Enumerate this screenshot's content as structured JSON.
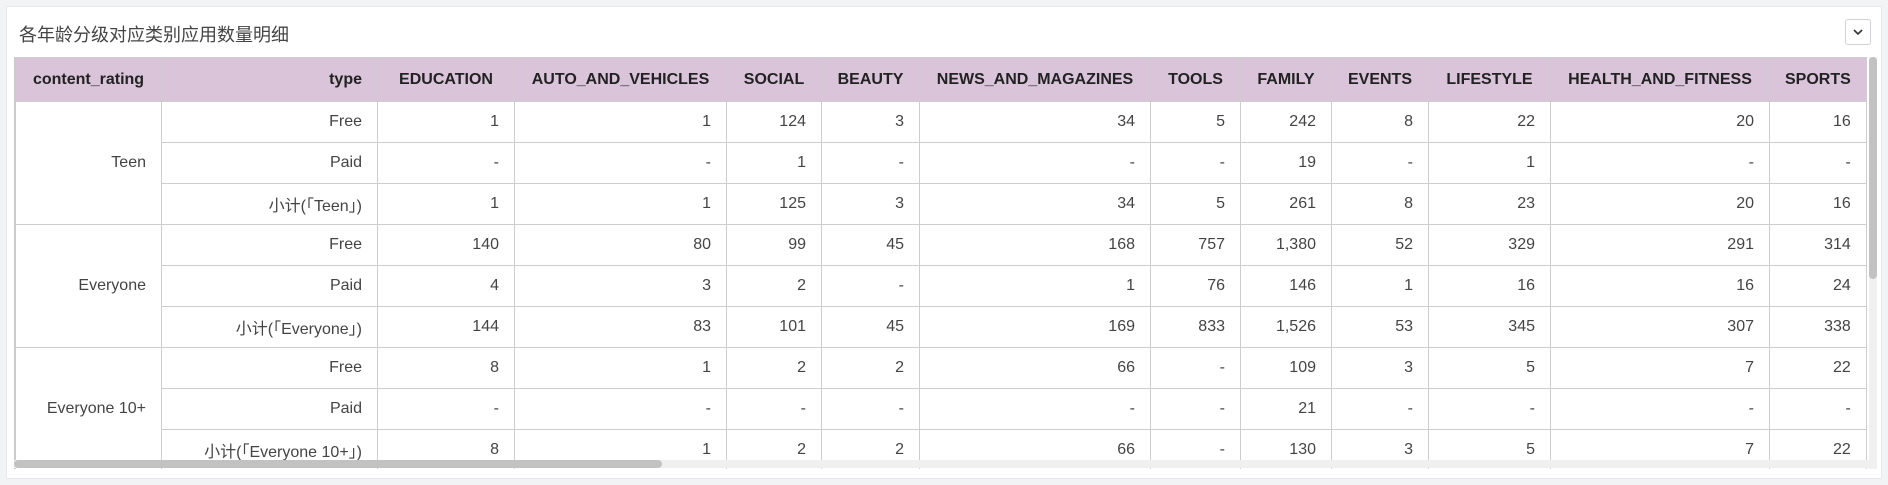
{
  "panel": {
    "title": "各年龄分级对应类别应用数量明细"
  },
  "table": {
    "headers": [
      "content_rating",
      "type",
      "EDUCATION",
      "AUTO_AND_VEHICLES",
      "SOCIAL",
      "BEAUTY",
      "NEWS_AND_MAGAZINES",
      "TOOLS",
      "FAMILY",
      "EVENTS",
      "LIFESTYLE",
      "HEALTH_AND_FITNESS",
      "SPORTS"
    ],
    "groups": [
      {
        "rating": "Teen",
        "rows": [
          {
            "type": "Free",
            "values": [
              "1",
              "1",
              "124",
              "3",
              "34",
              "5",
              "242",
              "8",
              "22",
              "20",
              "16"
            ]
          },
          {
            "type": "Paid",
            "values": [
              "-",
              "-",
              "1",
              "-",
              "-",
              "-",
              "19",
              "-",
              "1",
              "-",
              "-"
            ]
          },
          {
            "type": "小计(「Teen」)",
            "values": [
              "1",
              "1",
              "125",
              "3",
              "34",
              "5",
              "261",
              "8",
              "23",
              "20",
              "16"
            ]
          }
        ]
      },
      {
        "rating": "Everyone",
        "rows": [
          {
            "type": "Free",
            "values": [
              "140",
              "80",
              "99",
              "45",
              "168",
              "757",
              "1,380",
              "52",
              "329",
              "291",
              "314"
            ]
          },
          {
            "type": "Paid",
            "values": [
              "4",
              "3",
              "2",
              "-",
              "1",
              "76",
              "146",
              "1",
              "16",
              "16",
              "24"
            ]
          },
          {
            "type": "小计(「Everyone」)",
            "values": [
              "144",
              "83",
              "101",
              "45",
              "169",
              "833",
              "1,526",
              "53",
              "345",
              "307",
              "338"
            ]
          }
        ]
      },
      {
        "rating": "Everyone 10+",
        "rows": [
          {
            "type": "Free",
            "values": [
              "8",
              "1",
              "2",
              "2",
              "66",
              "-",
              "109",
              "3",
              "5",
              "7",
              "22"
            ]
          },
          {
            "type": "Paid",
            "values": [
              "-",
              "-",
              "-",
              "-",
              "-",
              "-",
              "21",
              "-",
              "-",
              "-",
              "-"
            ]
          },
          {
            "type": "小计(「Everyone 10+」)",
            "values": [
              "8",
              "1",
              "2",
              "2",
              "66",
              "-",
              "130",
              "3",
              "5",
              "7",
              "22"
            ]
          }
        ]
      }
    ]
  },
  "colors": {
    "header_bg": "#d9c4da",
    "border": "#cdcdcd"
  }
}
